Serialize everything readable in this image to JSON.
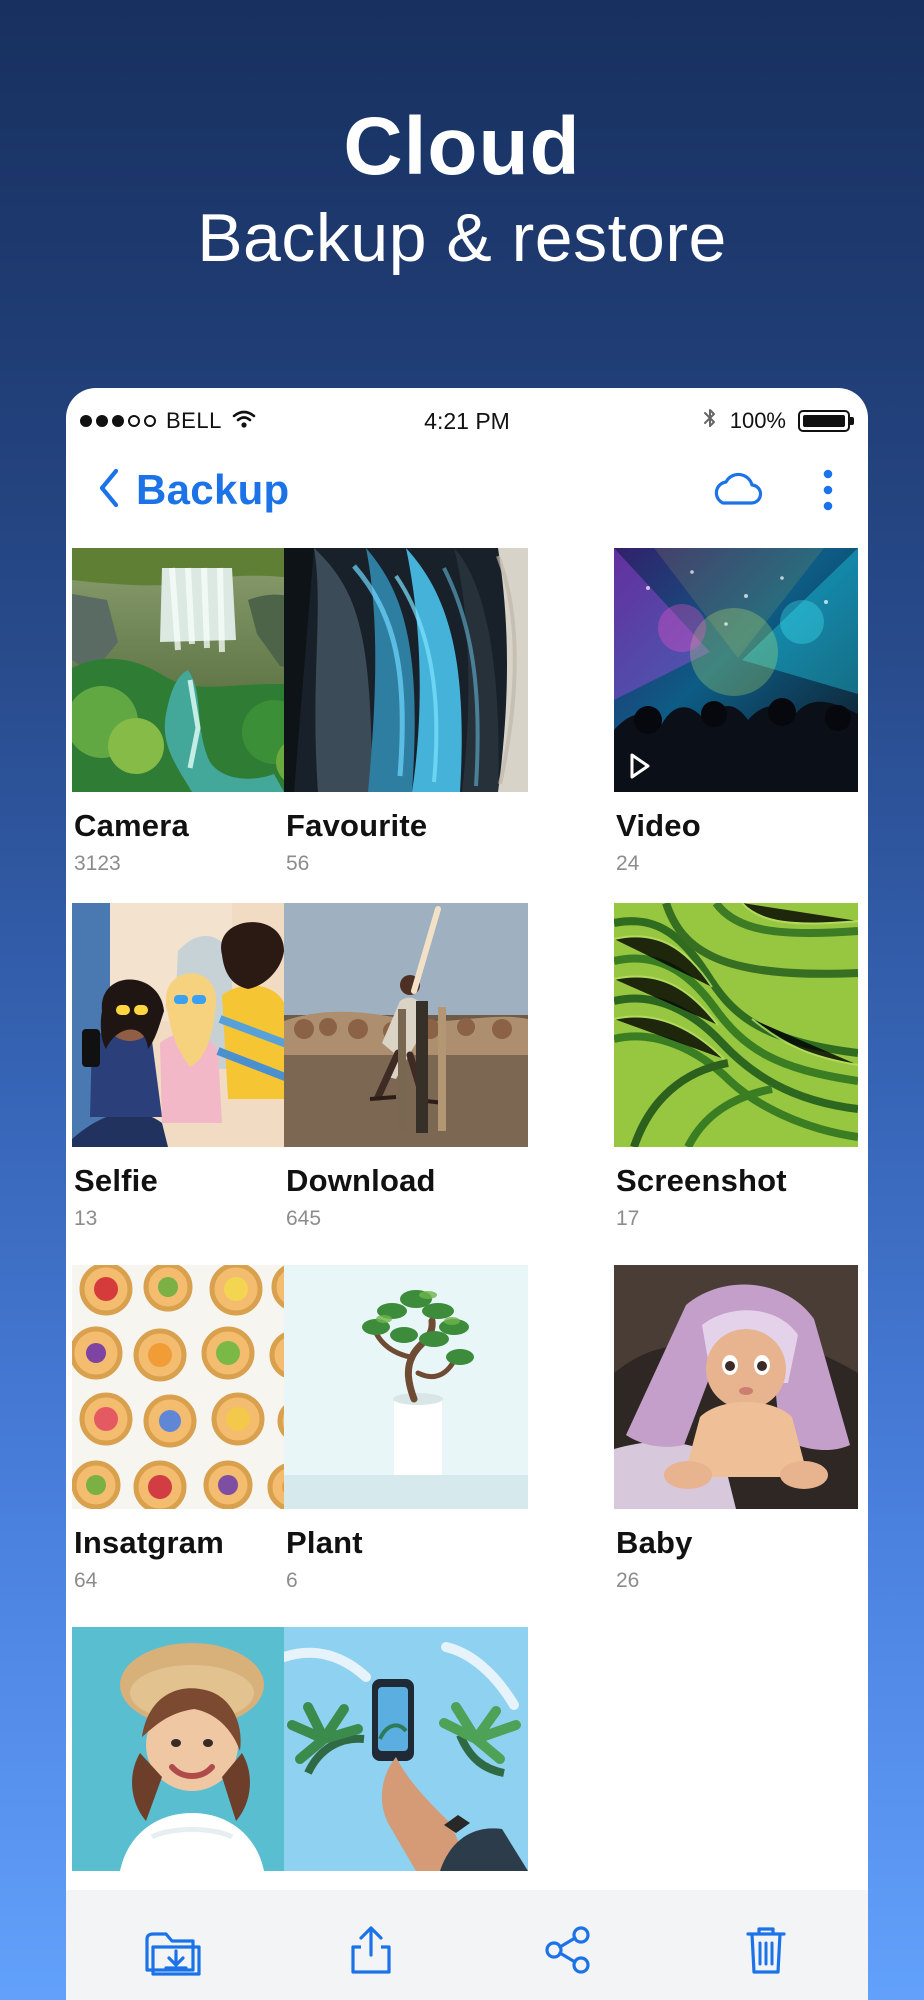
{
  "hero": {
    "title": "Cloud",
    "subtitle": "Backup & restore"
  },
  "status_bar": {
    "carrier": "BELL",
    "time": "4:21 PM",
    "battery": "100%",
    "icons": [
      "signal-dots-icon",
      "wifi-icon",
      "bluetooth-icon",
      "battery-icon"
    ]
  },
  "nav": {
    "back_label": "Backup",
    "icons": [
      "chevron-left-icon",
      "cloud-icon",
      "more-vertical-icon"
    ]
  },
  "albums": [
    {
      "name": "Camera",
      "count": "3123",
      "thumbnail": "waterfall-photo"
    },
    {
      "name": "Favourite",
      "count": "56",
      "thumbnail": "feathers-photo"
    },
    {
      "name": "Video",
      "count": "24",
      "thumbnail": "concert-photo",
      "icon": "play-icon"
    },
    {
      "name": "Selfie",
      "count": "13",
      "thumbnail": "selfie-photo"
    },
    {
      "name": "Download",
      "count": "645",
      "thumbnail": "cricket-photo"
    },
    {
      "name": "Screenshot",
      "count": "17",
      "thumbnail": "field-aerial-photo"
    },
    {
      "name": "Insatgram",
      "count": "64",
      "thumbnail": "pastries-photo"
    },
    {
      "name": "Plant",
      "count": "6",
      "thumbnail": "bonsai-photo"
    },
    {
      "name": "Baby",
      "count": "26",
      "thumbnail": "baby-photo"
    },
    {
      "name": "",
      "count": "",
      "thumbnail": "portrait-photo"
    },
    {
      "name": "",
      "count": "",
      "thumbnail": "phone-sky-photo"
    }
  ],
  "toolbar": {
    "icons": [
      "folder-download-icon",
      "share-icon",
      "share-nodes-icon",
      "trash-icon"
    ]
  },
  "colors": {
    "background_top": "#17305f",
    "background_bottom": "#62a1fb",
    "accent": "#1c73e8",
    "text": "#111111",
    "muted": "#8c8c8c",
    "toolbar": "#f3f4f6"
  }
}
